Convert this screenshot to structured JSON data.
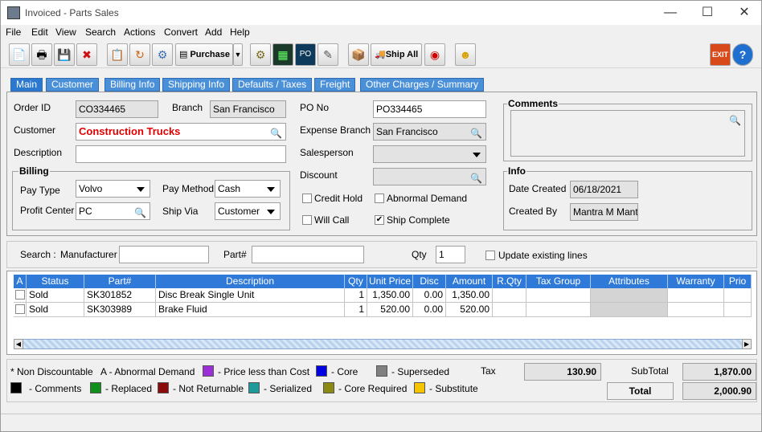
{
  "window": {
    "title": "Invoiced - Parts Sales",
    "minimize": "—",
    "maximize": "☐",
    "close": "✕"
  },
  "menu": [
    "File",
    "Edit",
    "View",
    "Search",
    "Actions",
    "Convert",
    "Add",
    "Help"
  ],
  "toolbar": {
    "purchase_label": "Purchase",
    "ship_all_label": "Ship All",
    "exit_label": "EXIT",
    "help_label": "?"
  },
  "tabs": [
    "Main",
    "Customer",
    "Billing Info",
    "Shipping Info",
    "Defaults / Taxes",
    "Freight",
    "Other Charges / Summary"
  ],
  "main": {
    "order_id_label": "Order ID",
    "order_id": "CO334465",
    "branch_label": "Branch",
    "branch": "San Francisco",
    "customer_label": "Customer",
    "customer": "Construction Trucks",
    "description_label": "Description",
    "description": "",
    "billing_title": "Billing",
    "pay_type_label": "Pay Type",
    "pay_type": "Volvo",
    "pay_method_label": "Pay Method",
    "pay_method": "Cash",
    "profit_center_label": "Profit Center",
    "profit_center": "PC",
    "ship_via_label": "Ship Via",
    "ship_via": "Customer",
    "po_no_label": "PO No",
    "po_no": "PO334465",
    "expense_branch_label": "Expense Branch",
    "expense_branch": "San Francisco",
    "salesperson_label": "Salesperson",
    "salesperson": "",
    "discount_label": "Discount",
    "discount": "",
    "credit_hold_label": "Credit Hold",
    "credit_hold": false,
    "abnormal_demand_label": "Abnormal Demand",
    "abnormal_demand": false,
    "will_call_label": "Will Call",
    "will_call": false,
    "ship_complete_label": "Ship Complete",
    "ship_complete": true,
    "comments_title": "Comments",
    "info_title": "Info",
    "date_created_label": "Date Created",
    "date_created": "06/18/2021",
    "created_by_label": "Created By",
    "created_by": "Mantra M Mantra"
  },
  "search": {
    "search_label": "Search :",
    "manufacturer_label": "Manufacturer",
    "manufacturer": "",
    "part_label": "Part#",
    "part": "",
    "qty_label": "Qty",
    "qty": "1",
    "update_label": "Update existing lines"
  },
  "grid": {
    "columns": [
      "A",
      "Status",
      "Part#",
      "Description",
      "Qty",
      "Unit Price",
      "Disc",
      "Amount",
      "R.Qty",
      "Tax Group",
      "Attributes",
      "Warranty",
      "Prio"
    ],
    "rows": [
      {
        "status": "Sold",
        "part": "SK301852",
        "description": "Disc Break Single Unit",
        "qty": "1",
        "unit_price": "1,350.00",
        "disc": "0.00",
        "amount": "1,350.00"
      },
      {
        "status": "Sold",
        "part": "SK303989",
        "description": "Brake Fluid",
        "qty": "1",
        "unit_price": "520.00",
        "disc": "0.00",
        "amount": "520.00"
      }
    ]
  },
  "legend": {
    "non_discountable": "* Non Discountable",
    "abnormal_demand": "A - Abnormal Demand",
    "items": [
      {
        "label": "- Price less than Cost",
        "color": "#9b30d9"
      },
      {
        "label": "- Core",
        "color": "#0000e0"
      },
      {
        "label": "- Superseded",
        "color": "#808080"
      },
      {
        "label": "- Comments",
        "color": "#000000"
      },
      {
        "label": "- Replaced",
        "color": "#10901a"
      },
      {
        "label": "- Not Returnable",
        "color": "#8b0a0a"
      },
      {
        "label": "- Serialized",
        "color": "#1f9a9a"
      },
      {
        "label": "- Core Required",
        "color": "#8a8a12"
      },
      {
        "label": "- Substitute",
        "color": "#f5c400"
      }
    ]
  },
  "totals": {
    "tax_label": "Tax",
    "tax": "130.90",
    "subtotal_label": "SubTotal",
    "subtotal": "1,870.00",
    "total_label": "Total",
    "total": "2,000.90"
  }
}
